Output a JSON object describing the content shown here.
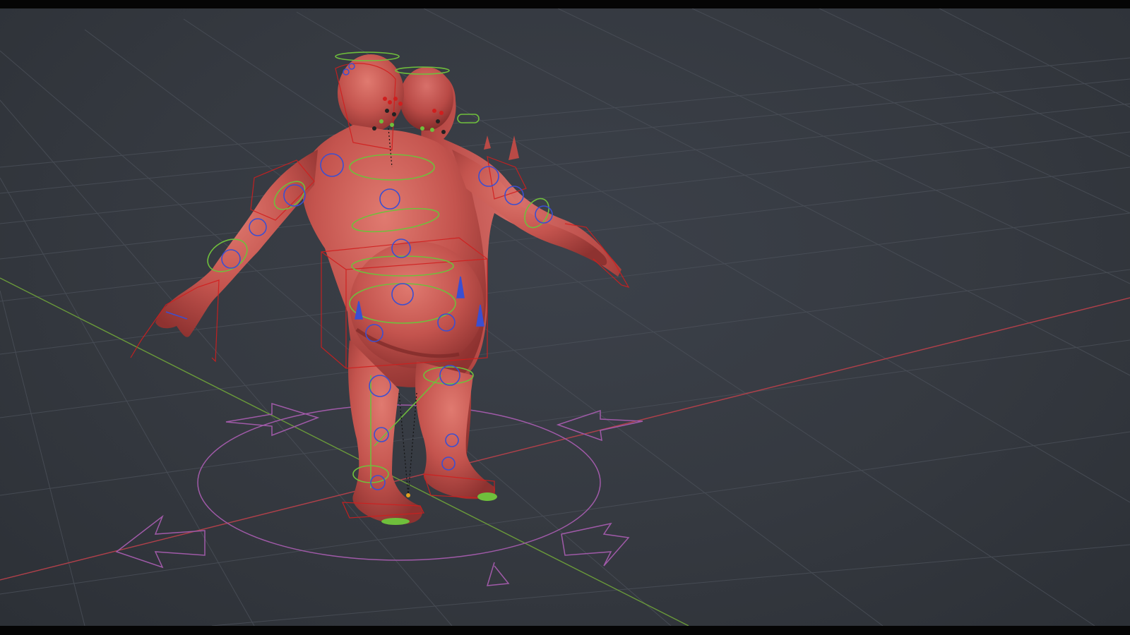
{
  "app": {
    "name": "3D Viewport"
  },
  "viewport": {
    "background_color": "#383c44",
    "grid_color": "#4a4f58",
    "x_axis_color": "#b0404a",
    "y_axis_color": "#6a9a3a"
  },
  "scene": {
    "mesh_color": "#c4544e",
    "rig_colors": {
      "fk_controls": "#3b4fd1",
      "ik_controls": "#6fbf3c",
      "deform_outline": "#d01e1e",
      "root_control": "#a05aa8"
    },
    "objects": [
      {
        "name": "character-mesh-front",
        "icon": "humanoid-mesh"
      },
      {
        "name": "character-mesh-back",
        "icon": "humanoid-mesh"
      },
      {
        "name": "armature-controls",
        "icon": "bone-icon"
      },
      {
        "name": "root-control",
        "icon": "move-arrows-icon"
      }
    ]
  }
}
